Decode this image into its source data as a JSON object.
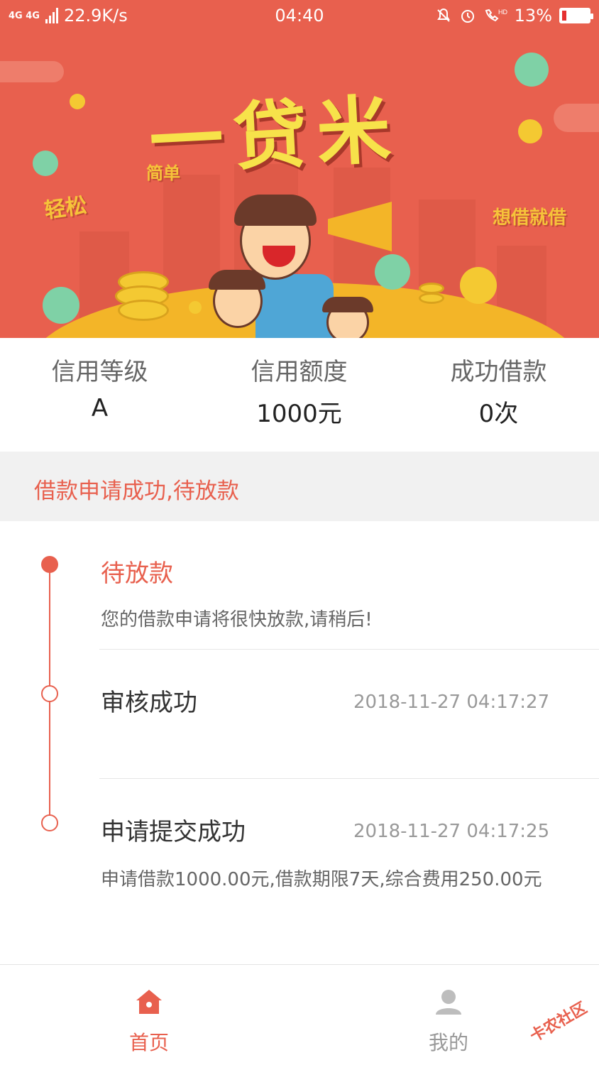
{
  "status_bar": {
    "network": "4G 4G",
    "speed": "22.9K/s",
    "time": "04:40",
    "battery": "13%",
    "icons": [
      "silent-bell-icon",
      "alarm-icon",
      "hd-call-icon",
      "battery-low-icon"
    ]
  },
  "banner": {
    "title": "一贷米",
    "tags": {
      "easy": "轻松",
      "simple": "简单",
      "borrow": "想借就借"
    }
  },
  "stats": [
    {
      "label": "信用等级",
      "value": "A"
    },
    {
      "label": "信用额度",
      "value": "1000元"
    },
    {
      "label": "成功借款",
      "value": "0次"
    }
  ],
  "loan_status": "借款申请成功,待放款",
  "timeline": [
    {
      "title": "待放款",
      "desc": "您的借款申请将很快放款,请稍后!",
      "time": "",
      "active": true
    },
    {
      "title": "审核成功",
      "desc": "",
      "time": "2018-11-27 04:17:27",
      "active": false
    },
    {
      "title": "申请提交成功",
      "desc": "申请借款1000.00元,借款期限7天,综合费用250.00元",
      "time": "2018-11-27 04:17:25",
      "active": false
    }
  ],
  "tabbar": {
    "items": [
      {
        "label": "首页",
        "icon": "home-icon",
        "active": true
      },
      {
        "label": "我的",
        "icon": "person-icon",
        "active": false
      }
    ]
  },
  "watermark": "卡农社区",
  "colors": {
    "accent": "#e8604e",
    "inactive": "#999999",
    "timeline_line": "#e8604e",
    "banner_yellow": "#f7e24a"
  }
}
